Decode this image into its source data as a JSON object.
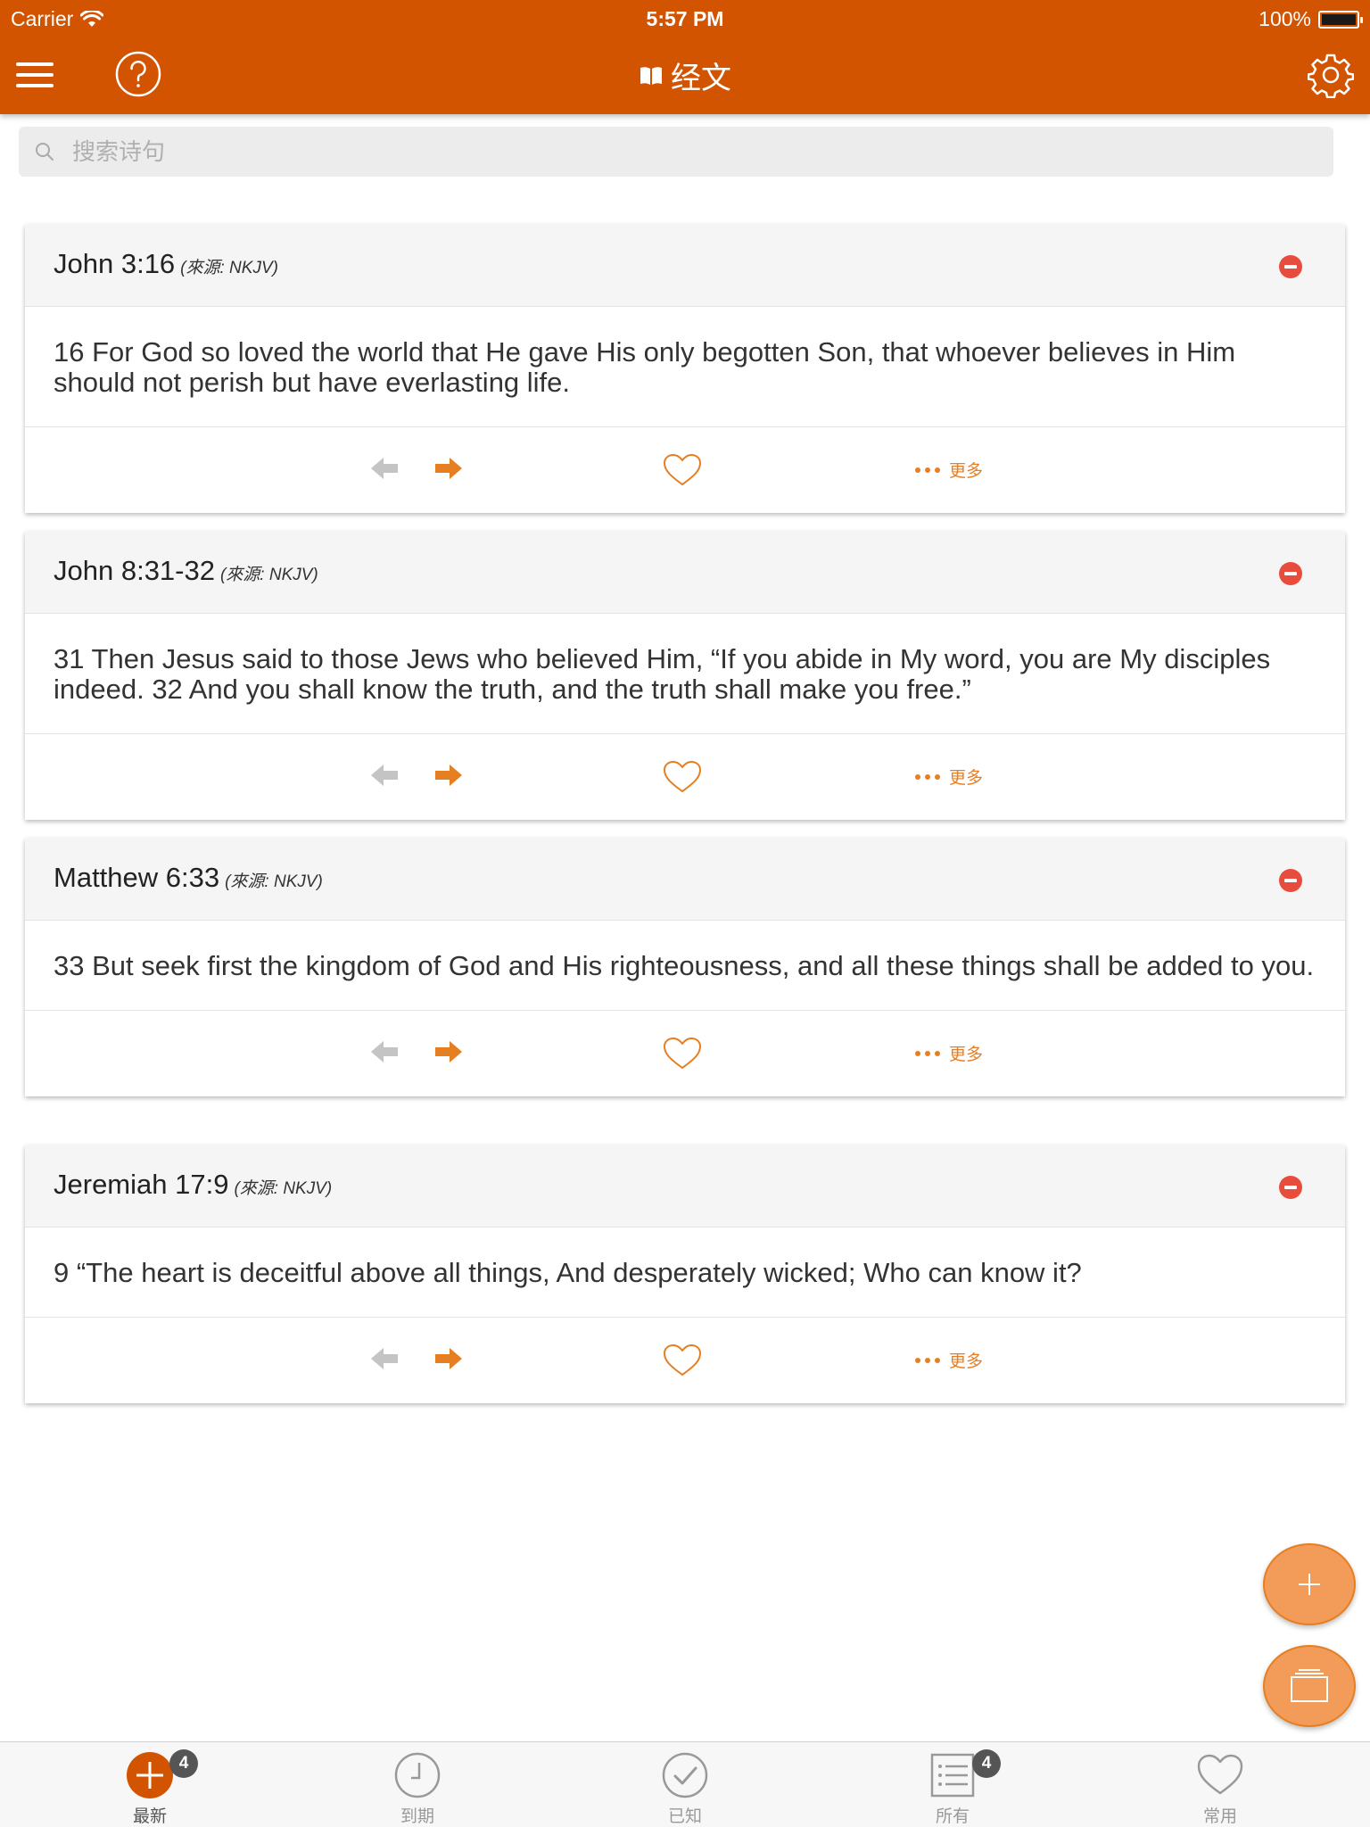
{
  "status_bar": {
    "carrier": "Carrier",
    "time": "5:57 PM",
    "battery": "100%"
  },
  "nav": {
    "title": "经文",
    "icons": [
      "menu-icon",
      "help-icon",
      "book-icon",
      "gear-icon"
    ]
  },
  "search": {
    "placeholder": "搜索诗句",
    "value": ""
  },
  "cards": [
    {
      "reference": "John 3:16",
      "source": "(來源: NKJV)",
      "text": "16 For God so loved the world that He gave His only begotten Son, that whoever believes in Him should not perish but have everlasting life.",
      "more_label": "更多"
    },
    {
      "reference": "John 8:31-32",
      "source": "(來源: NKJV)",
      "text": "31 Then Jesus said to those Jews who believed Him, “If you abide in My word, you are My disciples indeed. 32 And you shall know the truth, and the truth shall make you free.”",
      "more_label": "更多"
    },
    {
      "reference": "Matthew 6:33",
      "source": "(來源: NKJV)",
      "text": "33 But seek first the kingdom of God and His righteousness, and all these things shall be added to you.",
      "more_label": "更多"
    },
    {
      "reference": "Jeremiah 17:9",
      "source": "(來源: NKJV)",
      "text": "9 “The heart is deceitful above all things, And desperately wicked; Who can know it?",
      "more_label": "更多"
    }
  ],
  "tabs": [
    {
      "label": "最新",
      "badge": "4",
      "icon": "plus-circle-icon",
      "active": true
    },
    {
      "label": "到期",
      "badge": "",
      "icon": "clock-icon",
      "active": false
    },
    {
      "label": "已知",
      "badge": "",
      "icon": "check-circle-icon",
      "active": false
    },
    {
      "label": "所有",
      "badge": "4",
      "icon": "list-icon",
      "active": false
    },
    {
      "label": "常用",
      "badge": "",
      "icon": "heart-icon",
      "active": false
    }
  ],
  "colors": {
    "brand": "#d35400",
    "accent": "#e67e22",
    "remove": "#e74c3c",
    "fab": "#f39c5a"
  }
}
